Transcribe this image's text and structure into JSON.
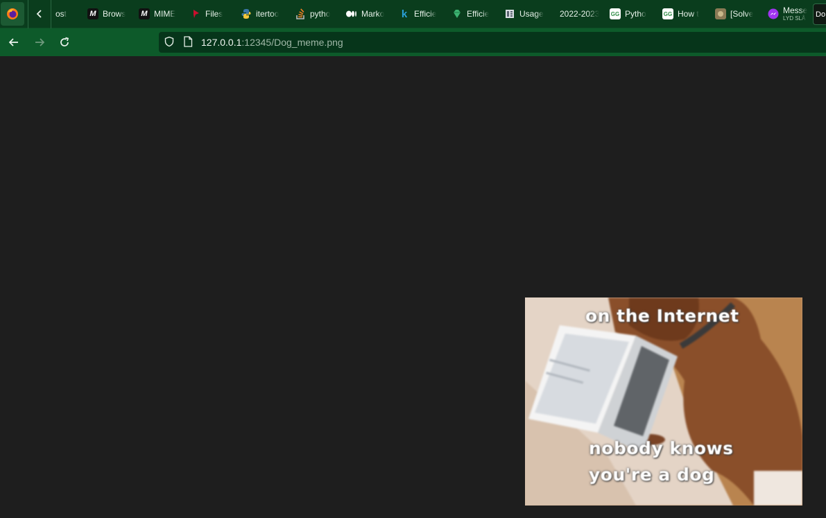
{
  "tabs": [
    {
      "label": "ost",
      "icon": "none"
    },
    {
      "label": "Brows",
      "icon": "mdn-icon"
    },
    {
      "label": "MIME",
      "icon": "mdn-icon"
    },
    {
      "label": "Files",
      "icon": "pin-icon"
    },
    {
      "label": "itertoo",
      "icon": "python-icon"
    },
    {
      "label": "pytho",
      "icon": "stackoverflow-icon"
    },
    {
      "label": "Marko",
      "icon": "medium-icon"
    },
    {
      "label": "Efficie",
      "icon": "k-icon"
    },
    {
      "label": "Efficie",
      "icon": "gem-icon"
    },
    {
      "label": "Usage",
      "icon": "doc-icon"
    },
    {
      "label": "2022-2023",
      "icon": "none"
    },
    {
      "label": "Pytho",
      "icon": "gfg-icon"
    },
    {
      "label": "How t",
      "icon": "gfg-icon"
    },
    {
      "label": "[Solve",
      "icon": "image-icon"
    },
    {
      "label": "Messe",
      "sublabel": "LYD SLÅ",
      "icon": "messenger-icon"
    }
  ],
  "last_tab": {
    "label": "Do"
  },
  "address": {
    "host": "127.0.0.1",
    "path": ":12345/Dog_meme.png"
  },
  "meme": {
    "top_text": "on the Internet",
    "bottom_line1": "nobody knows",
    "bottom_line2": "you're a dog"
  },
  "colors": {
    "tabstrip_bg": "#0a3d1d",
    "navbar_bg": "#0d5a2a",
    "urlbar_bg": "#06351a",
    "viewport_bg": "#1e1e1e"
  }
}
